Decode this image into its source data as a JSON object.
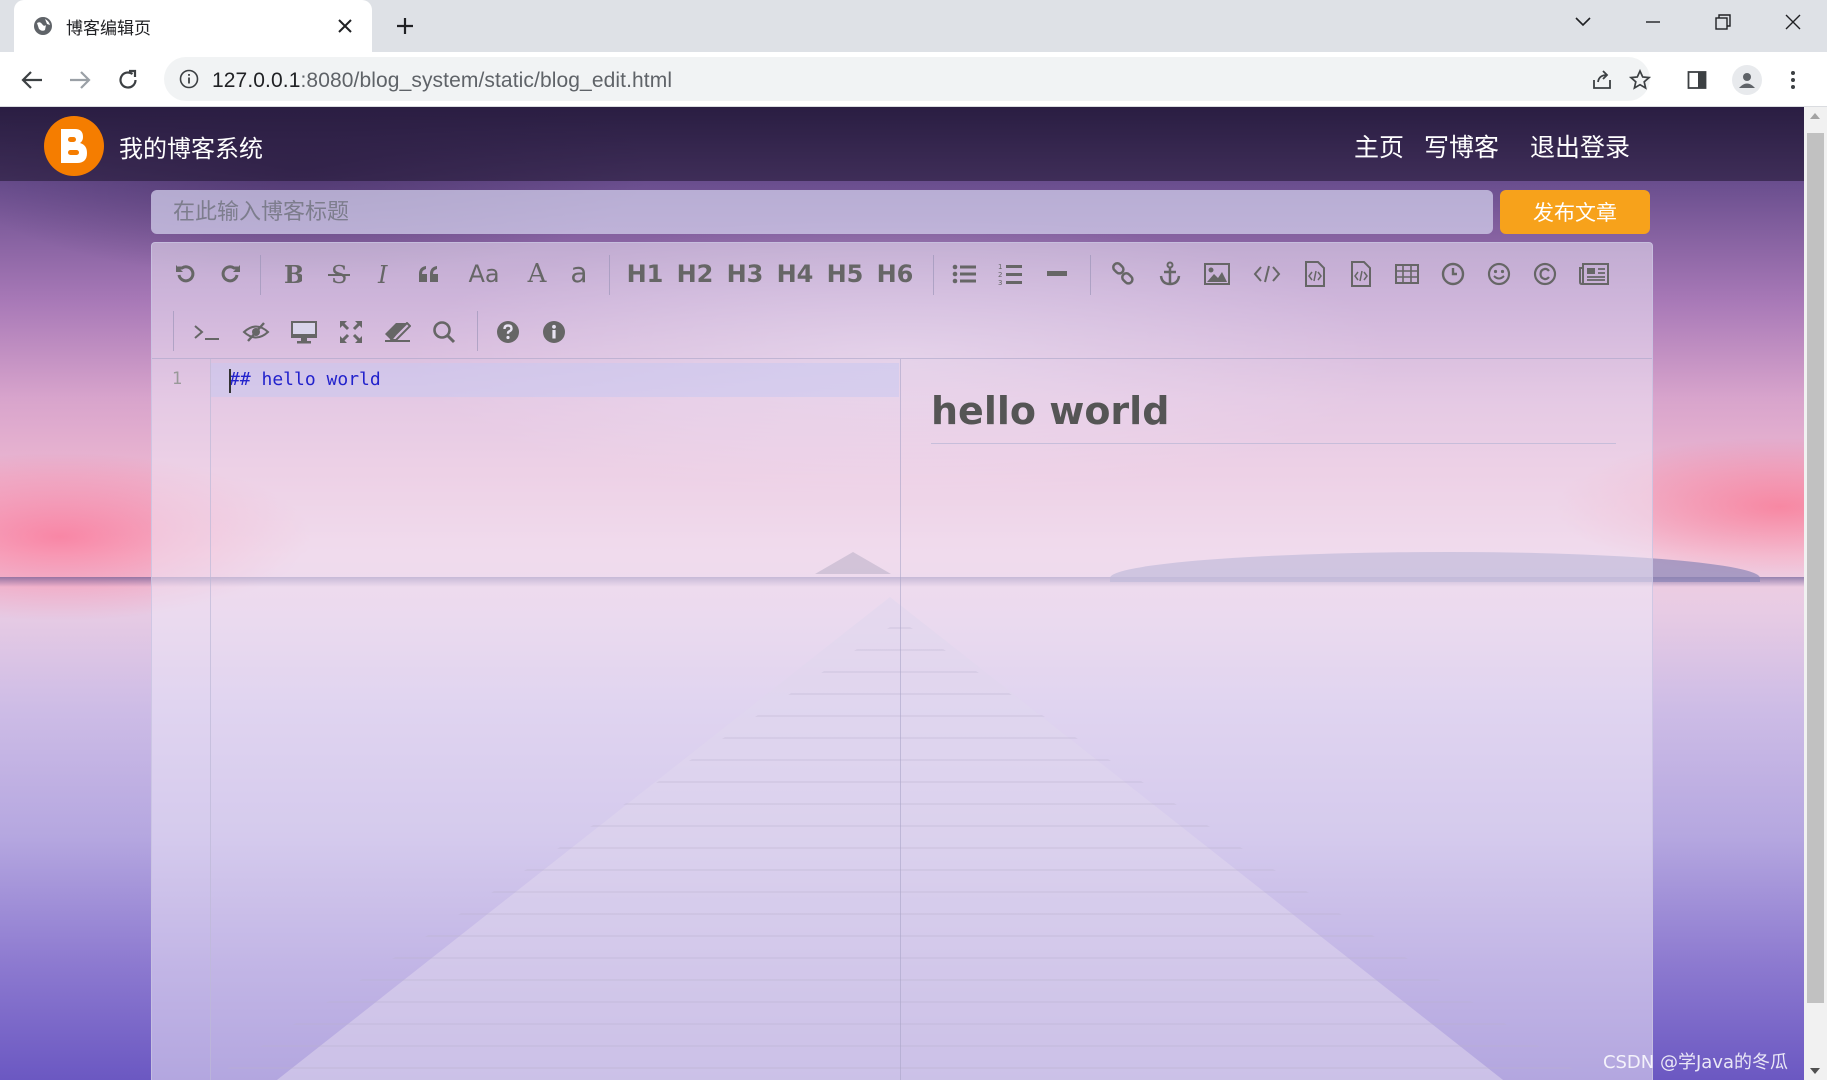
{
  "browser": {
    "tab_title": "博客编辑页",
    "url_host": "127.0.0.1",
    "url_path": ":8080/blog_system/static/blog_edit.html"
  },
  "site": {
    "title": "我的博客系统",
    "nav": [
      "主页",
      "写博客",
      "退出登录"
    ]
  },
  "editor": {
    "title_placeholder": "在此输入博客标题",
    "publish_label": "发布文章",
    "headings": [
      "H1",
      "H2",
      "H3",
      "H4",
      "H5",
      "H6"
    ],
    "case_label": "Aa",
    "upper_label": "A",
    "lower_label": "a",
    "line_number": "1",
    "markdown": "## hello world",
    "preview_heading": "hello world"
  },
  "watermark": "CSDN @学Java的冬瓜"
}
